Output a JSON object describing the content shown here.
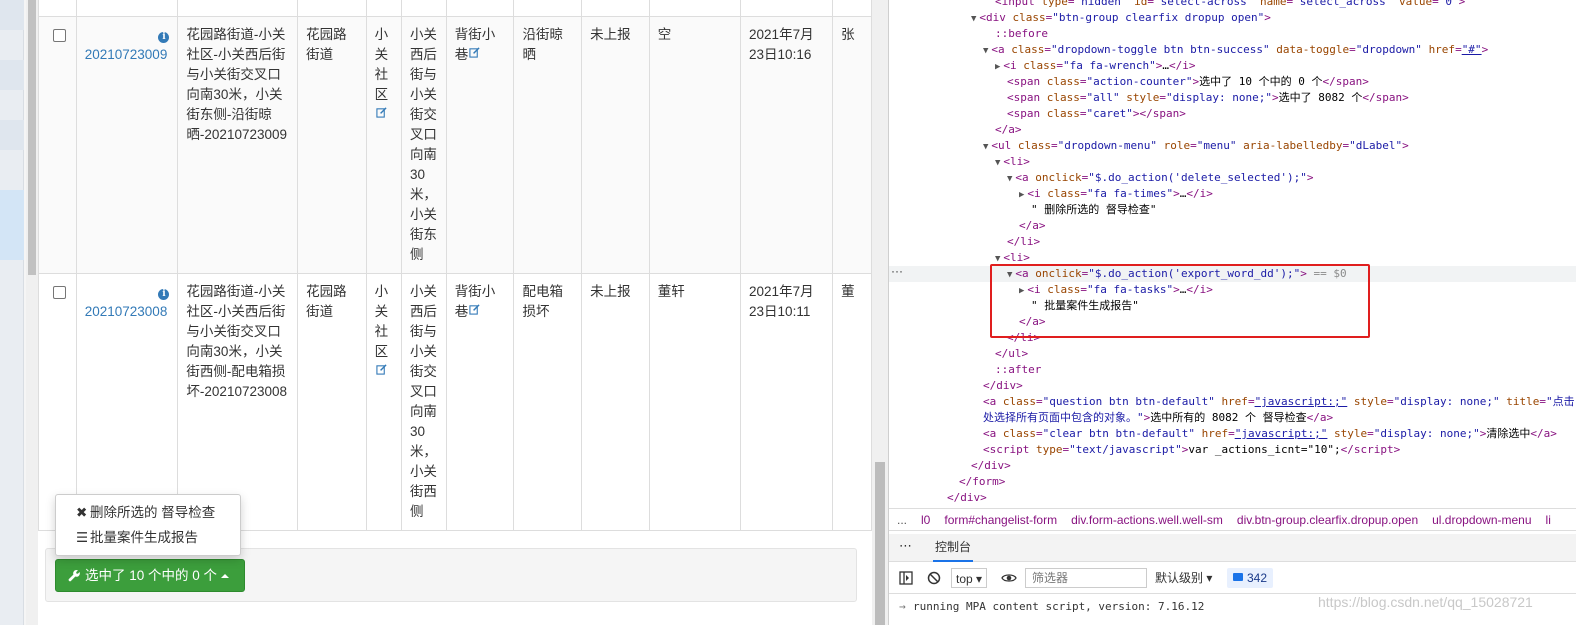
{
  "table": {
    "rows": [
      {
        "id": "20210723009",
        "location": "花园路街道-小关社区-小关西后街与小关街交叉口向南30米，小关街东侧-沿街晾晒-20210723009",
        "street": "花园路街道",
        "community": "小关社区",
        "address": "小关西后街与小关街交叉口向南30米，小关街东侧",
        "area": "背街小巷",
        "category": "沿街晾晒",
        "status": "未上报",
        "handler": "空",
        "time": "2021年7月23日10:16",
        "extra": "张"
      },
      {
        "id": "20210723008",
        "location": "花园路街道-小关社区-小关西后街与小关街交叉口向南30米，小关街西侧-配电箱损坏-20210723008",
        "street": "花园路街道",
        "community": "小关社区",
        "address": "小关西后街与小关街交叉口向南30米，小关街西侧",
        "area": "背街小巷",
        "category": "配电箱损坏",
        "status": "未上报",
        "handler": "董轩",
        "time": "2021年7月23日10:11",
        "extra": "董"
      }
    ]
  },
  "actions": {
    "button_label": "选中了 10 个中的 0 个",
    "menu": [
      {
        "icon": "times-icon",
        "label": "删除所选的 督导检查"
      },
      {
        "icon": "tasks-icon",
        "label": "批量案件生成报告"
      }
    ]
  },
  "devtools": {
    "lines": [
      {
        "indent": 8,
        "html": "<span class=\"tg\">&lt;input</span> <span class=\"an\">type</span>=<span class=\"av\">\"hidden\"</span> <span class=\"an\">id</span>=<span class=\"av\">\"select-across\"</span> <span class=\"an\">name</span>=<span class=\"av\">\"select_across\"</span> <span class=\"an\">value</span>=<span class=\"av\">\"0\"</span><span class=\"tg\">&gt;</span>"
      },
      {
        "indent": 6,
        "html": "<span class=\"tri\">▼</span><span class=\"tg\">&lt;div</span> <span class=\"an\">class</span>=<span class=\"av\">\"btn-group clearfix dropup open\"</span><span class=\"tg\">&gt;</span>"
      },
      {
        "indent": 8,
        "html": "<span class=\"pe\">::before</span>"
      },
      {
        "indent": 7,
        "html": "<span class=\"tri\">▼</span><span class=\"tg\">&lt;a</span> <span class=\"an\">class</span>=<span class=\"av\">\"dropdown-toggle btn btn-success\"</span> <span class=\"an\">data-toggle</span>=<span class=\"av\">\"dropdown\"</span> <span class=\"an\">href</span>=<span class=\"av ul\">\"#\"</span><span class=\"tg\">&gt;</span>"
      },
      {
        "indent": 8,
        "html": "<span class=\"tri\">▶</span><span class=\"tg\">&lt;i</span> <span class=\"an\">class</span>=<span class=\"av\">\"fa fa-wrench\"</span><span class=\"tg\">&gt;</span><span class=\"tx\">…</span><span class=\"tg\">&lt;/i&gt;</span>"
      },
      {
        "indent": 9,
        "html": "<span class=\"tg\">&lt;span</span> <span class=\"an\">class</span>=<span class=\"av\">\"action-counter\"</span><span class=\"tg\">&gt;</span><span class=\"tx\">选中了 10 个中的 0 个</span><span class=\"tg\">&lt;/span&gt;</span>"
      },
      {
        "indent": 9,
        "html": "<span class=\"tg\">&lt;span</span> <span class=\"an\">class</span>=<span class=\"av\">\"all\"</span> <span class=\"an\">style</span>=<span class=\"av\">\"display: none;\"</span><span class=\"tg\">&gt;</span><span class=\"tx\">选中了 8082 个</span><span class=\"tg\">&lt;/span&gt;</span>"
      },
      {
        "indent": 9,
        "html": "<span class=\"tg\">&lt;span</span> <span class=\"an\">class</span>=<span class=\"av\">\"caret\"</span><span class=\"tg\">&gt;&lt;/span&gt;</span>"
      },
      {
        "indent": 8,
        "html": "<span class=\"tg\">&lt;/a&gt;</span>"
      },
      {
        "indent": 7,
        "html": "<span class=\"tri\">▼</span><span class=\"tg\">&lt;ul</span> <span class=\"an\">class</span>=<span class=\"av\">\"dropdown-menu\"</span> <span class=\"an\">role</span>=<span class=\"av\">\"menu\"</span> <span class=\"an\">aria-labelledby</span>=<span class=\"av\">\"dLabel\"</span><span class=\"tg\">&gt;</span>"
      },
      {
        "indent": 8,
        "html": "<span class=\"tri\">▼</span><span class=\"tg\">&lt;li&gt;</span>"
      },
      {
        "indent": 9,
        "html": "<span class=\"tri\">▼</span><span class=\"tg\">&lt;a</span> <span class=\"an\">onclick</span>=<span class=\"av\">\"$.do_action('delete_selected');\"</span><span class=\"tg\">&gt;</span>"
      },
      {
        "indent": 10,
        "html": "<span class=\"tri\">▶</span><span class=\"tg\">&lt;i</span> <span class=\"an\">class</span>=<span class=\"av\">\"fa fa-times\"</span><span class=\"tg\">&gt;</span><span class=\"tx\">…</span><span class=\"tg\">&lt;/i&gt;</span>"
      },
      {
        "indent": 11,
        "html": "<span class=\"tx\">\" 删除所选的 督导检查\"</span>"
      },
      {
        "indent": 10,
        "html": "<span class=\"tg\">&lt;/a&gt;</span>"
      },
      {
        "indent": 9,
        "html": "<span class=\"tg\">&lt;/li&gt;</span>"
      },
      {
        "indent": 8,
        "html": "<span class=\"tri\">▼</span><span class=\"tg\">&lt;li&gt;</span>"
      },
      {
        "indent": 9,
        "selected": true,
        "html": "<span class=\"tri\">▼</span><span class=\"tg\">&lt;a</span> <span class=\"an\">onclick</span>=<span class=\"av\">\"$.do_action('export_word_dd');\"</span><span class=\"tg\">&gt;</span> <span class=\"cm\">== $0</span>"
      },
      {
        "indent": 10,
        "html": "<span class=\"tri\">▶</span><span class=\"tg\">&lt;i</span> <span class=\"an\">class</span>=<span class=\"av\">\"fa fa-tasks\"</span><span class=\"tg\">&gt;</span><span class=\"tx\">…</span><span class=\"tg\">&lt;/i&gt;</span>"
      },
      {
        "indent": 11,
        "html": "<span class=\"tx\">\" 批量案件生成报告\"</span>"
      },
      {
        "indent": 10,
        "html": "<span class=\"tg\">&lt;/a&gt;</span>"
      },
      {
        "indent": 9,
        "html": "<span class=\"tg\">&lt;/li&gt;</span>"
      },
      {
        "indent": 8,
        "html": "<span class=\"tg\">&lt;/ul&gt;</span>"
      },
      {
        "indent": 8,
        "html": "<span class=\"pe\">::after</span>"
      },
      {
        "indent": 7,
        "html": "<span class=\"tg\">&lt;/div&gt;</span>"
      },
      {
        "indent": 7,
        "html": "<span class=\"tg\">&lt;a</span> <span class=\"an\">class</span>=<span class=\"av\">\"question btn btn-default\"</span> <span class=\"an\">href</span>=<span class=\"av ul\">\"javascript:;\"</span> <span class=\"an\">style</span>=<span class=\"av\">\"display: none;\"</span> <span class=\"an\">title</span>=<span class=\"av\">\"点击</span>"
      },
      {
        "indent": 7,
        "html": "<span class=\"av\">处选择所有页面中包含的对象。\"</span><span class=\"tg\">&gt;</span><span class=\"tx\">选中所有的 8082 个 督导检查</span><span class=\"tg\">&lt;/a&gt;</span>"
      },
      {
        "indent": 7,
        "html": "<span class=\"tg\">&lt;a</span> <span class=\"an\">class</span>=<span class=\"av\">\"clear btn btn-default\"</span> <span class=\"an\">href</span>=<span class=\"av ul\">\"javascript:;\"</span> <span class=\"an\">style</span>=<span class=\"av\">\"display: none;\"</span><span class=\"tg\">&gt;</span><span class=\"tx\">清除选中</span><span class=\"tg\">&lt;/a&gt;</span>"
      },
      {
        "indent": 7,
        "html": "<span class=\"tg\">&lt;script</span> <span class=\"an\">type</span>=<span class=\"av\">\"text/javascript\"</span><span class=\"tg\">&gt;</span><span class=\"tx\">var _actions_icnt=\"10\";</span><span class=\"tg\">&lt;/script&gt;</span>"
      },
      {
        "indent": 6,
        "html": "<span class=\"tg\">&lt;/div&gt;</span>"
      },
      {
        "indent": 5,
        "html": "<span class=\"tg\">&lt;/form&gt;</span>"
      },
      {
        "indent": 4,
        "html": "<span class=\"tg\">&lt;/div&gt;</span>"
      }
    ],
    "crumbs": [
      "...",
      "l0",
      "form#changelist-form",
      "div.form-actions.well.well-sm",
      "div.btn-group.clearfix.dropup.open",
      "ul.dropdown-menu",
      "li"
    ],
    "more_tabs": "⋯",
    "console_tab": "控制台",
    "context": "top",
    "filter_placeholder": "筛选器",
    "level": "默认级别",
    "count": "342",
    "message": "running MPA content script, version: 7.16.12",
    "watermark": "https://blog.csdn.net/qq_15028721"
  }
}
